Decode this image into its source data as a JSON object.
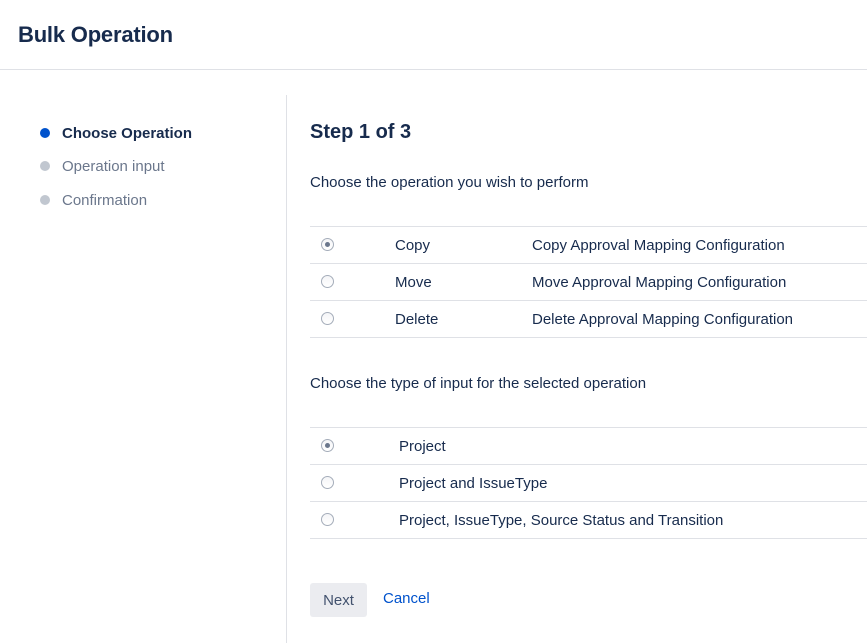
{
  "header": {
    "title": "Bulk Operation"
  },
  "steps": [
    {
      "label": "Choose Operation",
      "active": true
    },
    {
      "label": "Operation input",
      "active": false
    },
    {
      "label": "Confirmation",
      "active": false
    }
  ],
  "main": {
    "step_title": "Step 1 of 3",
    "operation_prompt": "Choose the operation you wish to perform",
    "operations": [
      {
        "name": "Copy",
        "description": "Copy Approval Mapping Configuration",
        "selected": true
      },
      {
        "name": "Move",
        "description": "Move Approval Mapping Configuration",
        "selected": false
      },
      {
        "name": "Delete",
        "description": "Delete Approval Mapping Configuration",
        "selected": false
      }
    ],
    "input_prompt": "Choose the type of input for the selected operation",
    "input_types": [
      {
        "label": "Project",
        "selected": true
      },
      {
        "label": "Project and IssueType",
        "selected": false
      },
      {
        "label": "Project, IssueType, Source Status and Transition",
        "selected": false
      }
    ]
  },
  "actions": {
    "next_label": "Next",
    "cancel_label": "Cancel"
  },
  "colors": {
    "accent": "#0052cc",
    "text": "#172b4d",
    "muted": "#6b778c",
    "border": "#dfe1e6"
  }
}
